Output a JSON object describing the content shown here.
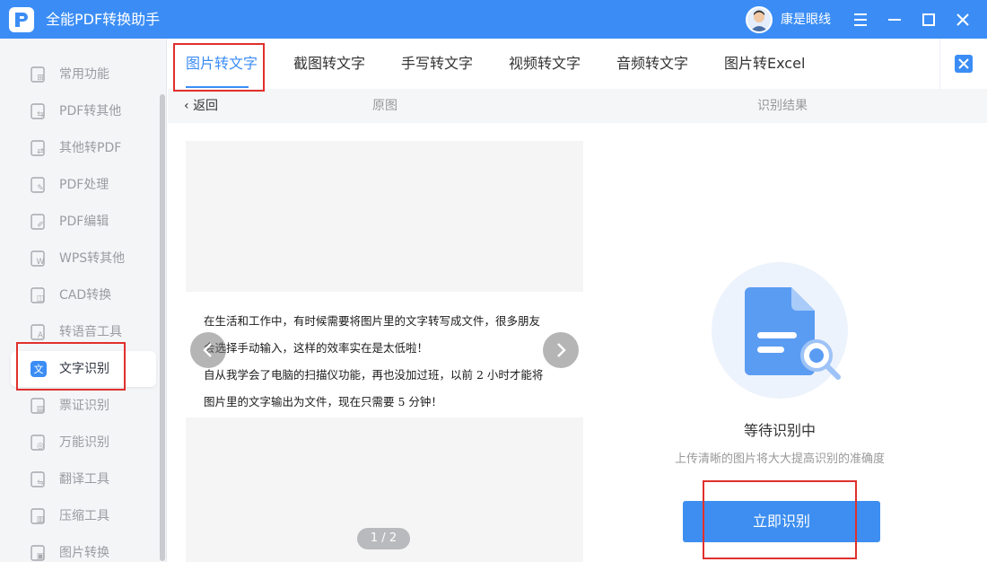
{
  "app": {
    "title": "全能PDF转换助手",
    "username": "康是眼线"
  },
  "colors": {
    "brand": "#3b8df5",
    "highlight": "#e0302d"
  },
  "titlebar_icons": [
    "menu-icon",
    "minimize-icon",
    "maximize-icon",
    "close-icon"
  ],
  "sidebar": {
    "items": [
      {
        "label": "常用功能",
        "icon": "common-functions-icon"
      },
      {
        "label": "PDF转其他",
        "icon": "pdf-convert-other-icon"
      },
      {
        "label": "其他转PDF",
        "icon": "other-to-pdf-icon"
      },
      {
        "label": "PDF处理",
        "icon": "pdf-process-icon"
      },
      {
        "label": "PDF编辑",
        "icon": "pdf-edit-icon"
      },
      {
        "label": "WPS转其他",
        "icon": "wps-convert-icon"
      },
      {
        "label": "CAD转换",
        "icon": "cad-convert-icon"
      },
      {
        "label": "转语音工具",
        "icon": "text-to-speech-icon"
      },
      {
        "label": "文字识别",
        "icon": "text-recognition-icon",
        "active": true
      },
      {
        "label": "票证识别",
        "icon": "ticket-recognition-icon"
      },
      {
        "label": "万能识别",
        "icon": "universal-recognition-icon"
      },
      {
        "label": "翻译工具",
        "icon": "translate-tool-icon"
      },
      {
        "label": "压缩工具",
        "icon": "compress-tool-icon"
      },
      {
        "label": "图片转换",
        "icon": "image-convert-icon"
      }
    ]
  },
  "tabs": [
    {
      "label": "图片转文字",
      "active": true
    },
    {
      "label": "截图转文字"
    },
    {
      "label": "手写转文字"
    },
    {
      "label": "视频转文字"
    },
    {
      "label": "音频转文字"
    },
    {
      "label": "图片转Excel"
    }
  ],
  "subheader": {
    "back_label": "返回",
    "original_label": "原图",
    "result_label": "识别结果"
  },
  "original_image": {
    "lines": [
      "在生活和工作中，有时候需要将图片里的文字转写成文件，很多朋友",
      "会选择手动输入，这样的效率实在是太低啦！",
      "自从我学会了电脑的扫描仪功能，再也没加过班，以前 2 小时才能将",
      "图片里的文字输出为文件，现在只需要 5 分钟！"
    ],
    "page_indicator": "1 / 2"
  },
  "result": {
    "status_title": "等待识别中",
    "hint": "上传清晰的图片将大大提高识别的准确度",
    "button_label": "立即识别"
  }
}
